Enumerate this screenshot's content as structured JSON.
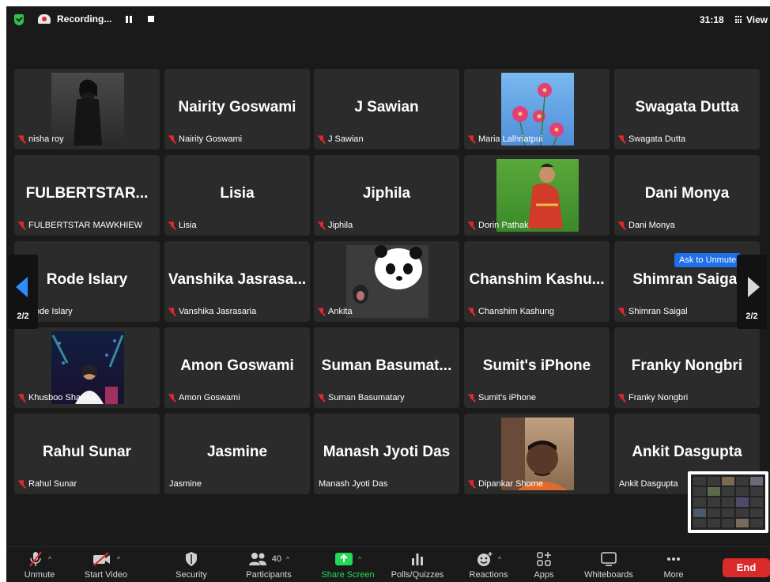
{
  "topbar": {
    "recording_label": "Recording...",
    "timer": "31:18",
    "view_label": "View"
  },
  "tiles": [
    {
      "big": "",
      "label": "nisha roy",
      "photo": "person-dark"
    },
    {
      "big": "Nairity Goswami",
      "label": "Nairity Goswami"
    },
    {
      "big": "J Sawian",
      "label": "J Sawian"
    },
    {
      "big": "",
      "label": "Maria Lalhriatpui",
      "photo": "pink-flowers"
    },
    {
      "big": "Swagata Dutta",
      "label": "Swagata Dutta"
    },
    {
      "big": "FULBERTSTAR...",
      "label": "FULBERTSTAR MAWKHIEW"
    },
    {
      "big": "Lisia",
      "label": "Lisia"
    },
    {
      "big": "Jiphila",
      "label": "Jiphila"
    },
    {
      "big": "",
      "label": "Dorin Pathak",
      "photo": "child-green"
    },
    {
      "big": "Dani Monya",
      "label": "Dani Monya"
    },
    {
      "big": "Rode Islary",
      "label": "Rode Islary"
    },
    {
      "big": "Vanshika Jasrasa...",
      "label": "Vanshika Jasrasaria"
    },
    {
      "big": "",
      "label": "Ankita",
      "photo": "panda"
    },
    {
      "big": "Chanshim Kashu...",
      "label": "Chanshim Kashung"
    },
    {
      "big": "Shimran Saigal",
      "label": "Shimran Saigal"
    },
    {
      "big": "",
      "label": "Khusboo Sharma",
      "photo": "night-lights"
    },
    {
      "big": "Amon Goswami",
      "label": "Amon Goswami"
    },
    {
      "big": "Suman Basumat...",
      "label": "Suman Basumatary"
    },
    {
      "big": "Sumit's iPhone",
      "label": "Sumit's iPhone"
    },
    {
      "big": "Franky Nongbri",
      "label": "Franky Nongbri"
    },
    {
      "big": "Rahul Sunar",
      "label": "Rahul Sunar"
    },
    {
      "big": "Jasmine",
      "label": "Jasmine"
    },
    {
      "big": "Manash Jyoti Das",
      "label": "Manash Jyoti Das"
    },
    {
      "big": "",
      "label": "Dipankar Shome",
      "photo": "man-face"
    },
    {
      "big": "Ankit Dasgupta",
      "label": "Ankit Dasgupta"
    }
  ],
  "ask_unmute": "Ask to Unmute",
  "page_indicator": "2/2",
  "toolbar": {
    "unmute": "Unmute",
    "start_video": "Start Video",
    "security": "Security",
    "participants": "Participants",
    "participants_count": "40",
    "share_screen": "Share Screen",
    "polls": "Polls/Quizzes",
    "reactions": "Reactions",
    "apps": "Apps",
    "whiteboards": "Whiteboards",
    "more": "More",
    "end": "End"
  },
  "colors": {
    "share_green": "#23d959",
    "end_red": "#d92b2b",
    "muted_red": "#e0282e",
    "accent_blue": "#2d8cff"
  }
}
